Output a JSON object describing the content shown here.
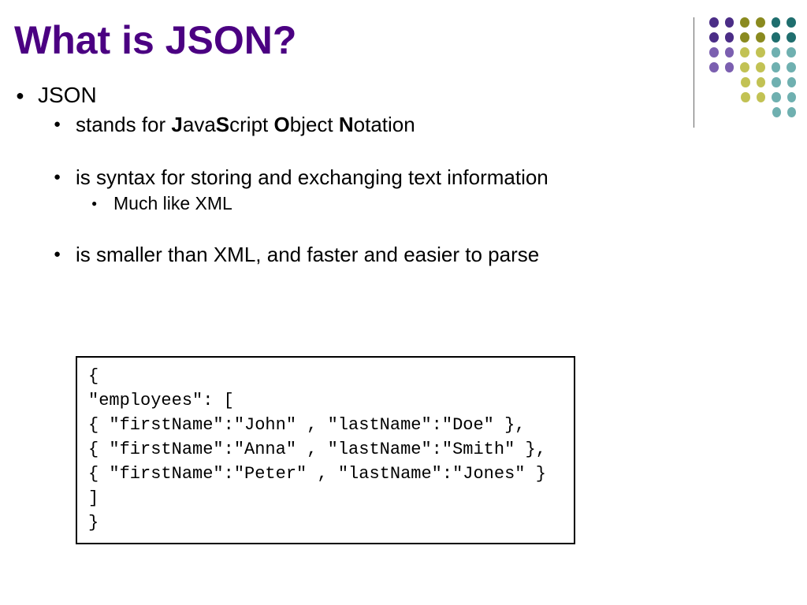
{
  "title": "What is JSON?",
  "bullets": {
    "l1": "JSON",
    "l2a_prefix": "stands for ",
    "acronym": {
      "j": "J",
      "ava": "ava",
      "s": "S",
      "cript": "cript ",
      "o": "O",
      "bject": "bject ",
      "n": "N",
      "otation": "otation"
    },
    "l2b": "is syntax for storing and exchanging text information",
    "l3b": "Much like XML",
    "l2c": "is smaller than XML, and faster and easier to parse"
  },
  "code": "{\n\"employees\": [\n{ \"firstName\":\"John\" , \"lastName\":\"Doe\" },\n{ \"firstName\":\"Anna\" , \"lastName\":\"Smith\" },\n{ \"firstName\":\"Peter\" , \"lastName\":\"Jones\" }\n]\n}"
}
